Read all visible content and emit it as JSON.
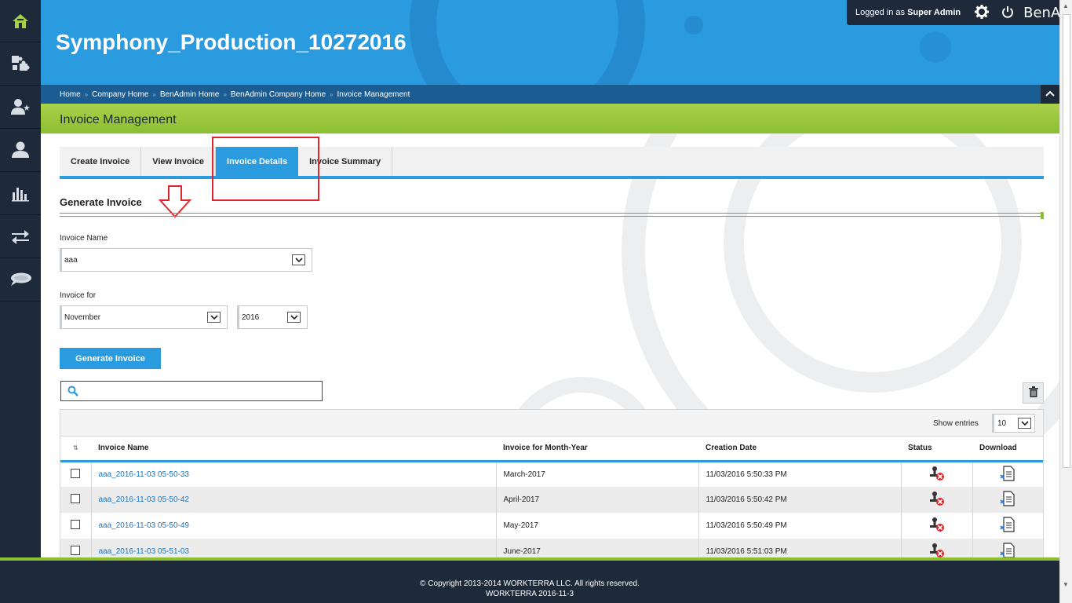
{
  "header": {
    "app_title": "Symphony_Production_10272016",
    "login_prefix": "Logged in as ",
    "login_user": "Super Admin",
    "brand": "BenAdmin"
  },
  "breadcrumb": [
    "Home",
    "Company Home",
    "BenAdmin Home",
    "BenAdmin Company Home",
    "Invoice Management"
  ],
  "breadcrumb_separator": "»",
  "page_title": "Invoice Management",
  "tabs": [
    {
      "label": "Create Invoice",
      "active": false
    },
    {
      "label": "View Invoice",
      "active": false
    },
    {
      "label": "Invoice Details",
      "active": true
    },
    {
      "label": "Invoice Summary",
      "active": false
    }
  ],
  "sidebar_icons": [
    "home-icon",
    "puzzle-icon",
    "user-star-icon",
    "user-icon",
    "bar-chart-icon",
    "transfer-icon",
    "chat-icon"
  ],
  "form": {
    "section_title": "Generate Invoice",
    "invoice_name_label": "Invoice Name",
    "invoice_name_value": "aaa",
    "invoice_for_label": "Invoice for",
    "month_value": "November",
    "year_value": "2016",
    "generate_button": "Generate Invoice"
  },
  "search": {
    "placeholder": ""
  },
  "table": {
    "show_entries_label": "Show entries",
    "entries_value": "10",
    "columns": [
      "Invoice Name",
      "Invoice for Month-Year",
      "Creation Date",
      "Status",
      "Download"
    ],
    "rows": [
      {
        "name": "aaa_2016-11-03 05-50-33",
        "month_year": "March-2017",
        "created": "11/03/2016 5:50:33 PM"
      },
      {
        "name": "aaa_2016-11-03 05-50-42",
        "month_year": "April-2017",
        "created": "11/03/2016 5:50:42 PM"
      },
      {
        "name": "aaa_2016-11-03 05-50-49",
        "month_year": "May-2017",
        "created": "11/03/2016 5:50:49 PM"
      },
      {
        "name": "aaa_2016-11-03 05-51-03",
        "month_year": "June-2017",
        "created": "11/03/2016 5:51:03 PM"
      }
    ]
  },
  "footer": {
    "copyright": "© Copyright 2013-2014 WORKTERRA LLC. All rights reserved.",
    "version": "WORKTERRA 2016-11-3"
  },
  "colors": {
    "primary_blue": "#2b9be0",
    "navy": "#1e2a3a",
    "green": "#8cbf32",
    "annotation_red": "#e0262c"
  }
}
